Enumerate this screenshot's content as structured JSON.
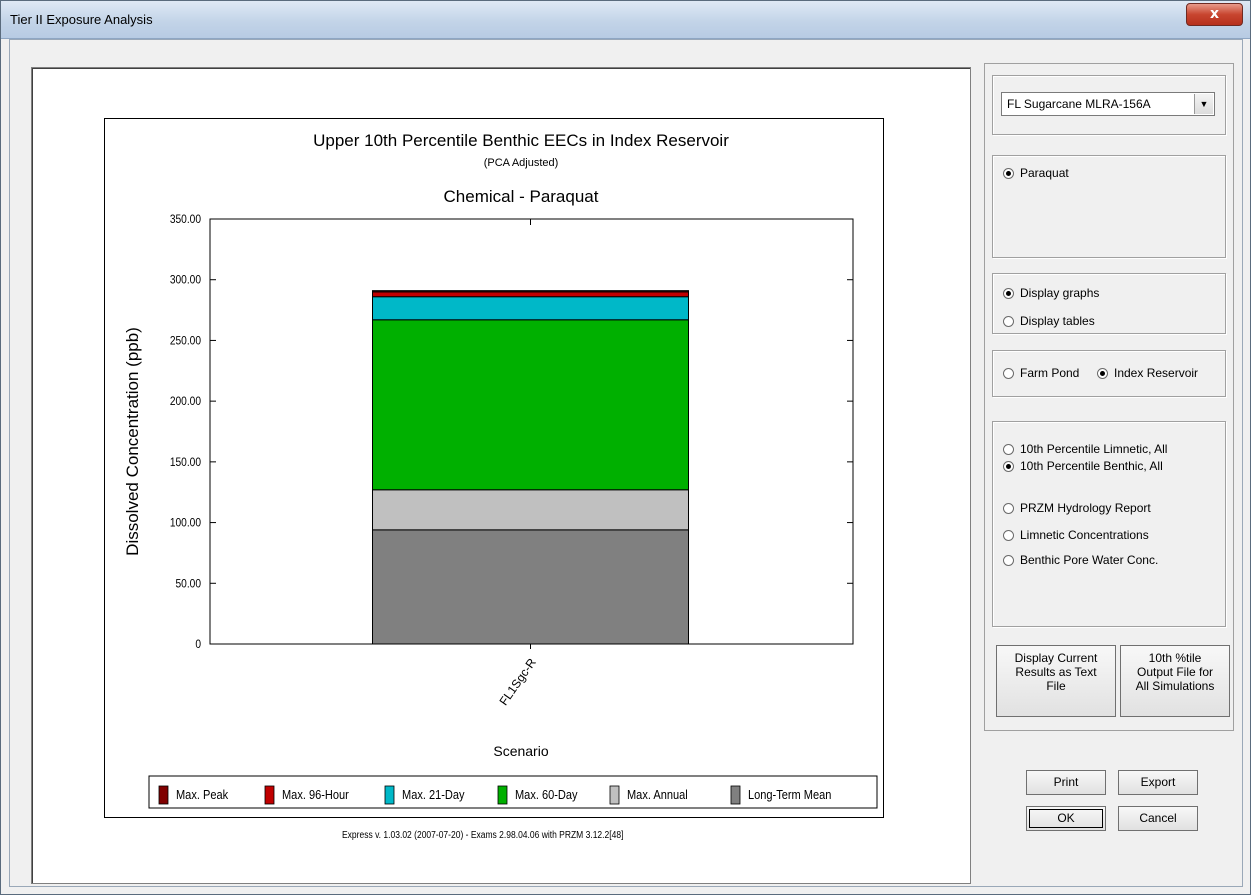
{
  "window": {
    "title": "Tier II Exposure Analysis",
    "close_glyph": "x"
  },
  "chart_data": {
    "type": "bar",
    "stacked": true,
    "title": "Upper 10th Percentile Benthic EECs in Index Reservoir",
    "subtitle": "(PCA Adjusted)",
    "subtitle2": "Chemical - Paraquat",
    "xlabel": "Scenario",
    "ylabel": "Dissolved Concentration (ppb)",
    "categories": [
      "FL1Sgc-R"
    ],
    "ylim": [
      0,
      350
    ],
    "yticks": [
      "350.00",
      "300.00",
      "250.00",
      "200.00",
      "150.00",
      "100.00",
      "50.00",
      "0"
    ],
    "series": [
      {
        "name": "Long-Term Mean",
        "values": [
          94
        ],
        "color": "#808080"
      },
      {
        "name": "Max. Annual",
        "values": [
          33
        ],
        "color": "#c0c0c0"
      },
      {
        "name": "Max. 60-Day",
        "values": [
          140
        ],
        "color": "#00b000"
      },
      {
        "name": "Max. 21-Day",
        "values": [
          19
        ],
        "color": "#00b8c8"
      },
      {
        "name": "Max. 96-Hour",
        "values": [
          4
        ],
        "color": "#c00000"
      },
      {
        "name": "Max. Peak",
        "values": [
          1
        ],
        "color": "#800000"
      }
    ],
    "legend": [
      {
        "name": "Max. Peak",
        "color": "#800000"
      },
      {
        "name": "Max. 96-Hour",
        "color": "#c00000"
      },
      {
        "name": "Max. 21-Day",
        "color": "#00b8c8"
      },
      {
        "name": "Max. 60-Day",
        "color": "#00b000"
      },
      {
        "name": "Max. Annual",
        "color": "#c0c0c0"
      },
      {
        "name": "Long-Term Mean",
        "color": "#808080"
      }
    ],
    "legend_position": "bottom"
  },
  "footer": "Express  v. 1.03.02  (2007-07-20) - Exams 2.98.04.06 with PRZM 3.12.2[48]",
  "scenario_select": {
    "value": "FL Sugarcane  MLRA-156A",
    "arrow": "▼"
  },
  "chemical": {
    "label": "Paraquat"
  },
  "display": {
    "graphs": "Display graphs",
    "tables": "Display tables"
  },
  "waterbody": {
    "pond": "Farm Pond",
    "reservoir": "Index Reservoir"
  },
  "reports": [
    {
      "label": "10th Percentile Limnetic, All",
      "checked": false
    },
    {
      "label": "10th Percentile Benthic, All",
      "checked": true
    },
    {
      "label": "PRZM Hydrology Report",
      "checked": false
    },
    {
      "label": "Limnetic Concentrations",
      "checked": false
    },
    {
      "label": "Benthic Pore Water Conc.",
      "checked": false
    }
  ],
  "buttons": {
    "display_current": [
      "Display Current",
      "Results as Text",
      "File"
    ],
    "tenth_output": [
      "10th %tile",
      "Output  File for",
      "All Simulations"
    ],
    "print": "Print",
    "export": "Export",
    "ok": "OK",
    "cancel": "Cancel"
  }
}
